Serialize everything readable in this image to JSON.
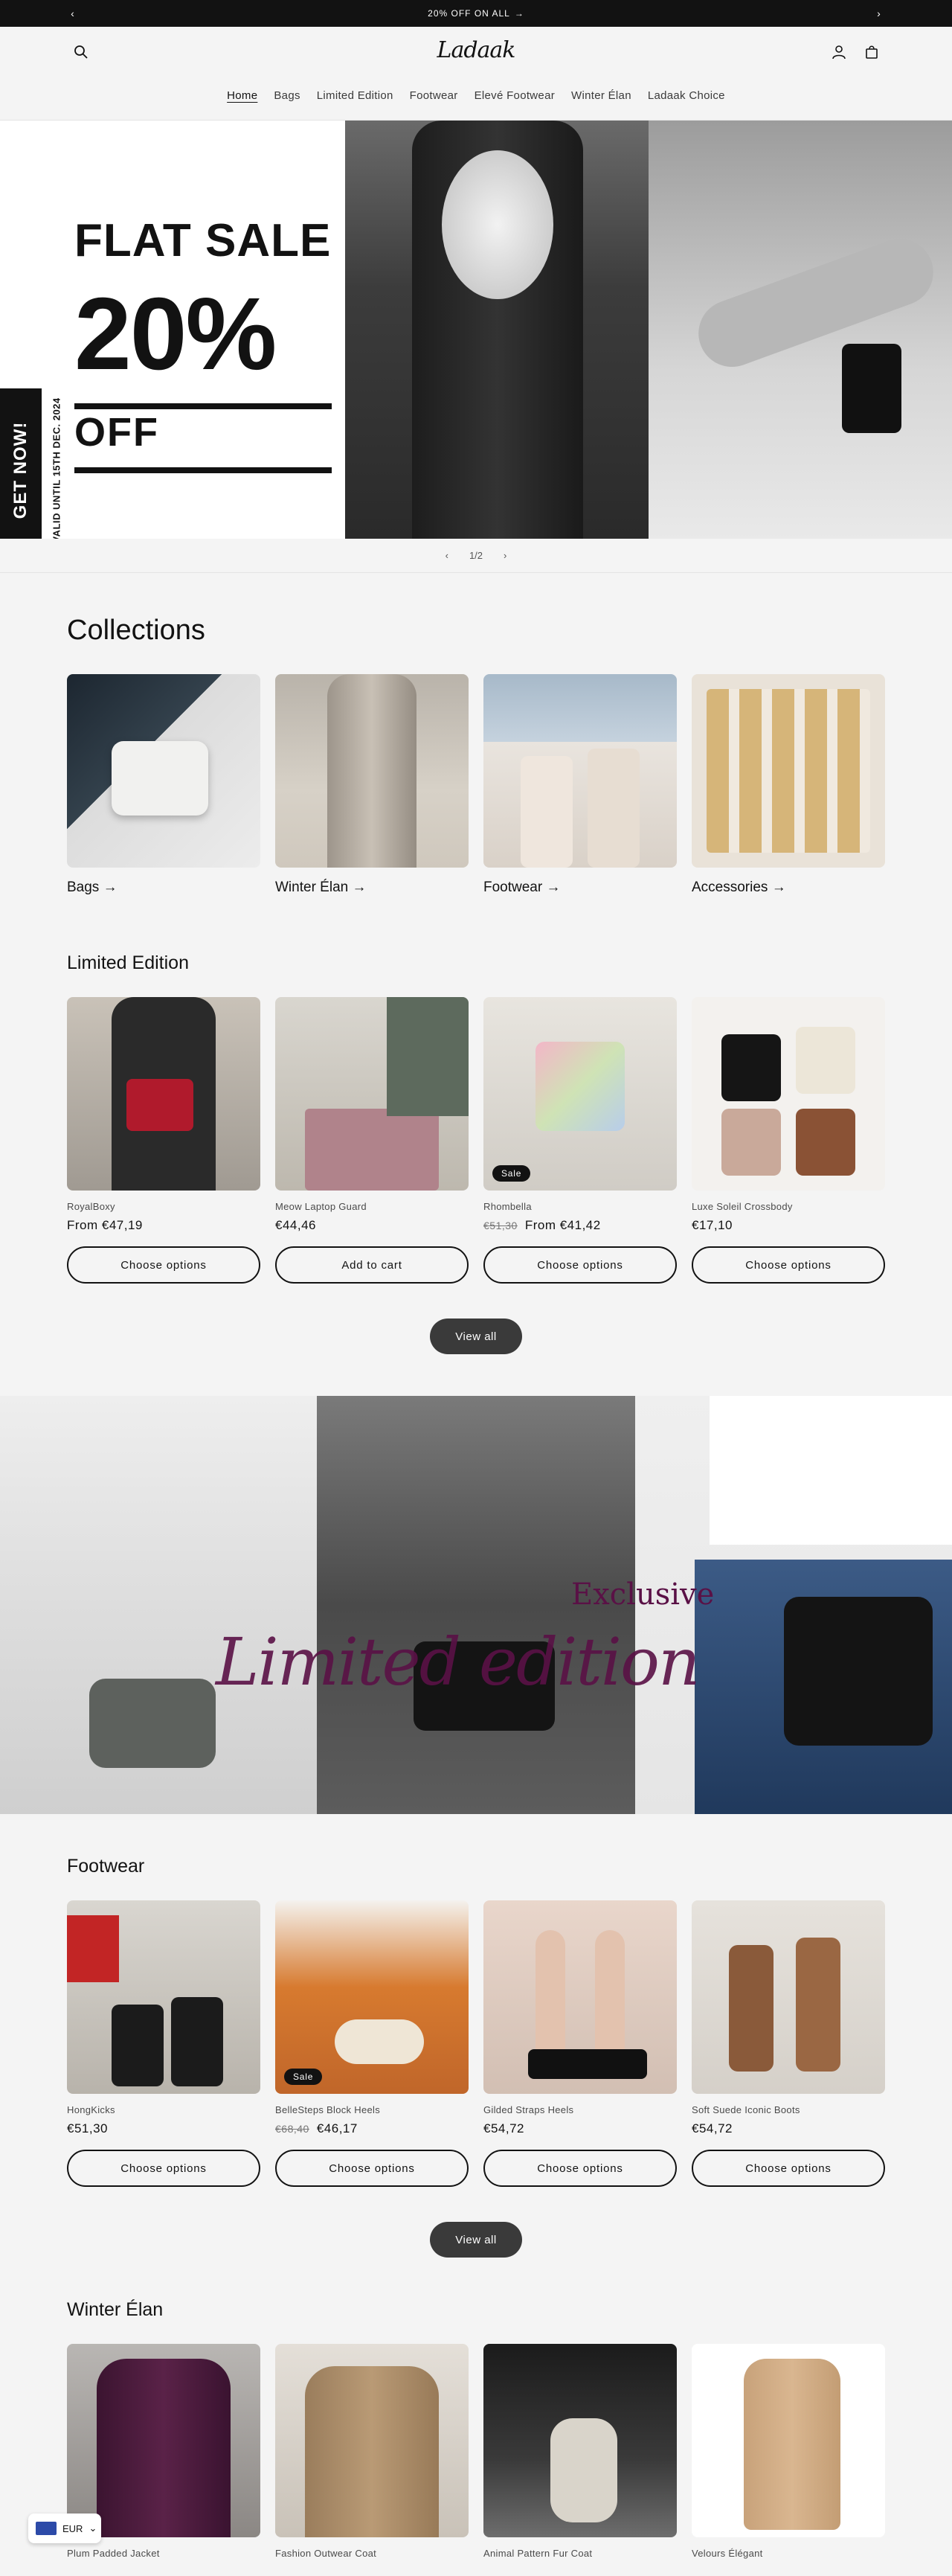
{
  "announcement": {
    "text": "20% OFF ON ALL",
    "arrow": "→",
    "prev": "‹",
    "next": "›"
  },
  "header": {
    "logo": "Ladaak",
    "nav": [
      "Home",
      "Bags",
      "Limited Edition",
      "Footwear",
      "Elevé Footwear",
      "Winter Élan",
      "Ladaak Choice"
    ]
  },
  "hero": {
    "cta": "GET NOW!",
    "valid": "VALID UNTIL 15TH DEC. 2024",
    "line1": "FLAT SALE",
    "line2": "20%",
    "line3": "OFF",
    "pager": "1/2",
    "prev": "‹",
    "next": "›"
  },
  "collections": {
    "title": "Collections",
    "items": [
      {
        "label": "Bags →"
      },
      {
        "label": "Winter Élan →"
      },
      {
        "label": "Footwear →"
      },
      {
        "label": "Accessories →"
      }
    ]
  },
  "limited": {
    "title": "Limited Edition",
    "products": [
      {
        "name": "RoyalBoxy",
        "price": "From €47,19",
        "old_price": "",
        "button": "Choose options",
        "sale": ""
      },
      {
        "name": "Meow Laptop Guard",
        "price": "€44,46",
        "old_price": "",
        "button": "Add to cart",
        "sale": ""
      },
      {
        "name": "Rhombella",
        "price": "From €41,42",
        "old_price": "€51,30",
        "button": "Choose options",
        "sale": "Sale"
      },
      {
        "name": "Luxe Soleil Crossbody",
        "price": "€17,10",
        "old_price": "",
        "button": "Choose options",
        "sale": ""
      }
    ],
    "view_all": "View all"
  },
  "banner": {
    "exclusive": "Exclusive",
    "script": "Limited edition"
  },
  "footwear": {
    "title": "Footwear",
    "products": [
      {
        "name": "HongKicks",
        "price": "€51,30",
        "old_price": "",
        "button": "Choose options",
        "sale": ""
      },
      {
        "name": "BelleSteps Block Heels",
        "price": "€46,17",
        "old_price": "€68,40",
        "button": "Choose options",
        "sale": "Sale"
      },
      {
        "name": "Gilded Straps Heels",
        "price": "€54,72",
        "old_price": "",
        "button": "Choose options",
        "sale": ""
      },
      {
        "name": "Soft Suede Iconic Boots",
        "price": "€54,72",
        "old_price": "",
        "button": "Choose options",
        "sale": ""
      }
    ],
    "view_all": "View all"
  },
  "winter": {
    "title": "Winter Élan",
    "products": [
      {
        "name": "Plum Padded Jacket"
      },
      {
        "name": "Fashion Outwear Coat"
      },
      {
        "name": "Animal Pattern Fur Coat"
      },
      {
        "name": "Velours Élégant"
      }
    ]
  },
  "currency": {
    "code": "EUR",
    "caret": "⌄"
  }
}
